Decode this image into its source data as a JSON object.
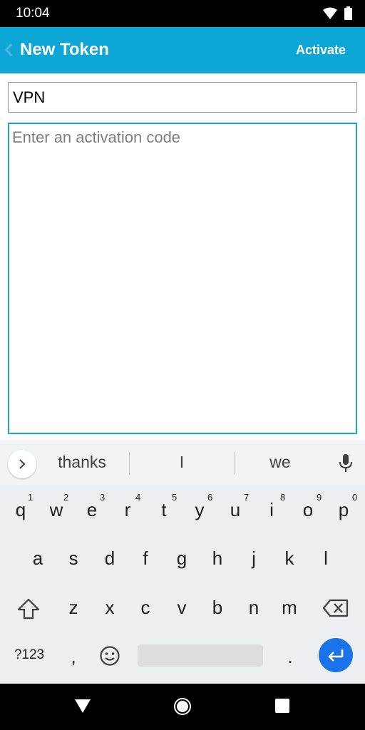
{
  "status_bar": {
    "time": "10:04",
    "icons": [
      "wifi-icon",
      "battery-icon"
    ]
  },
  "app_bar": {
    "title": "New Token",
    "action_label": "Activate",
    "color": "#0ea5d7"
  },
  "form": {
    "name_value": "VPN",
    "code_placeholder": "Enter an activation code"
  },
  "keyboard": {
    "suggestions": [
      "thanks",
      "I",
      "we"
    ],
    "row1": [
      "q",
      "w",
      "e",
      "r",
      "t",
      "y",
      "u",
      "i",
      "o",
      "p"
    ],
    "row1_numbers": [
      "1",
      "2",
      "3",
      "4",
      "5",
      "6",
      "7",
      "8",
      "9",
      "0"
    ],
    "row2": [
      "a",
      "s",
      "d",
      "f",
      "g",
      "h",
      "j",
      "k",
      "l"
    ],
    "row3": [
      "z",
      "x",
      "c",
      "v",
      "b",
      "n",
      "m"
    ],
    "symbols_label": "?123",
    "comma_label": ",",
    "period_label": ".",
    "accent_color": "#1a73e8"
  },
  "nav_bar": {
    "icons": [
      "back-triangle-icon",
      "home-circle-icon",
      "recents-square-icon"
    ]
  }
}
